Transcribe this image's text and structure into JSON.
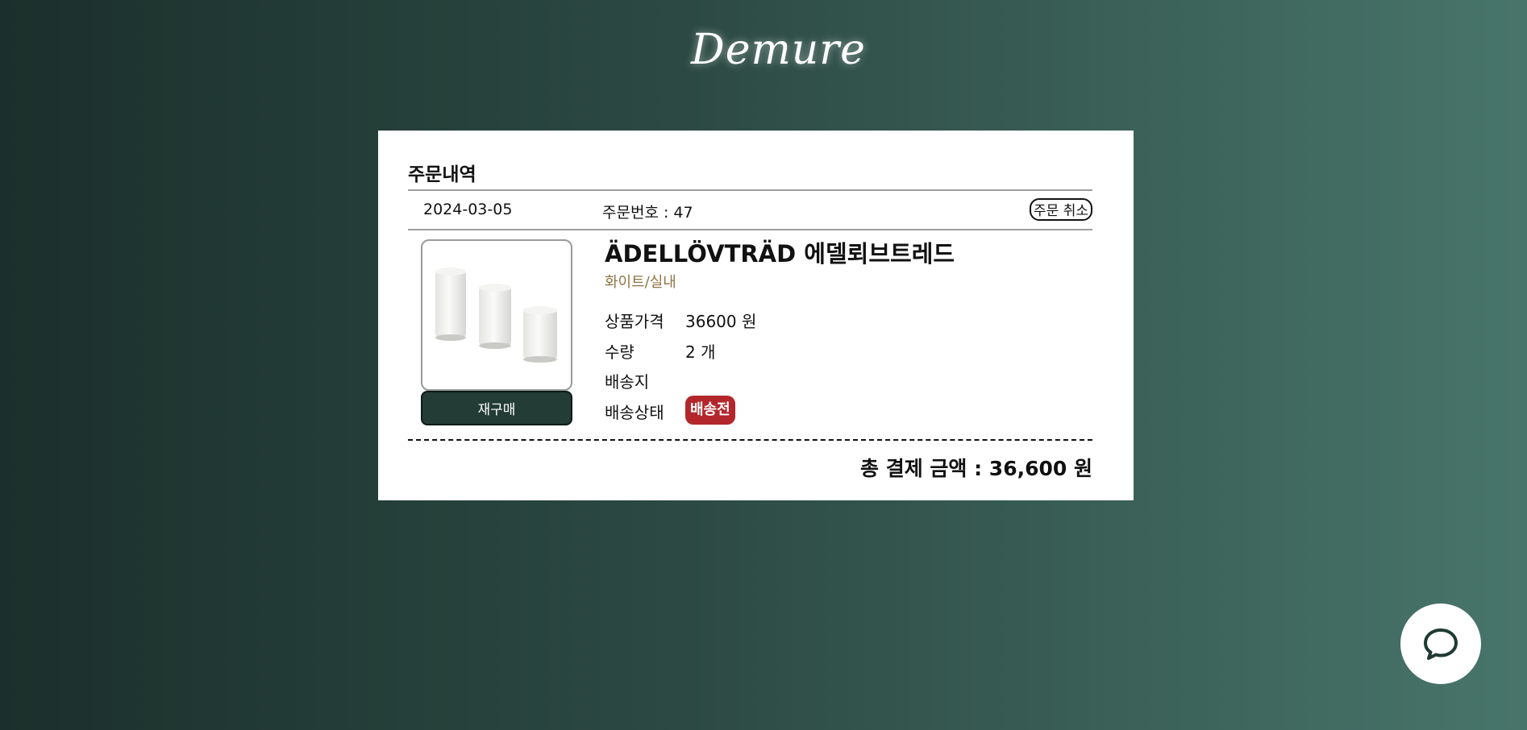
{
  "header": {
    "logo_text": "Demure"
  },
  "order_card": {
    "title": "주문내역",
    "date": "2024-03-05",
    "order_number": "주문번호 : 47",
    "cancel_label": "주문 취소",
    "product": {
      "name": "ÄDELLÖVTRÄD 에델뢰브트레드",
      "option": "화이트/실내",
      "image_icon": "white-candles-image"
    },
    "rebuy_label": "재구매",
    "info": {
      "price_label": "상품가격",
      "price_value": "36600 원",
      "qty_label": "수량",
      "qty_value": "2 개",
      "address_label": "배송지",
      "address_value": "",
      "status_label": "배송상태",
      "status_value": "배송전"
    },
    "total": "총 결제 금액 : 36,600 원"
  },
  "chat": {
    "icon": "chat-bubble-icon"
  },
  "colors": {
    "background_start": "#1b2f2b",
    "background_end": "#48756b",
    "button_dark": "#233c35",
    "status_red": "#b3272c",
    "option_gold": "#8e7444"
  }
}
